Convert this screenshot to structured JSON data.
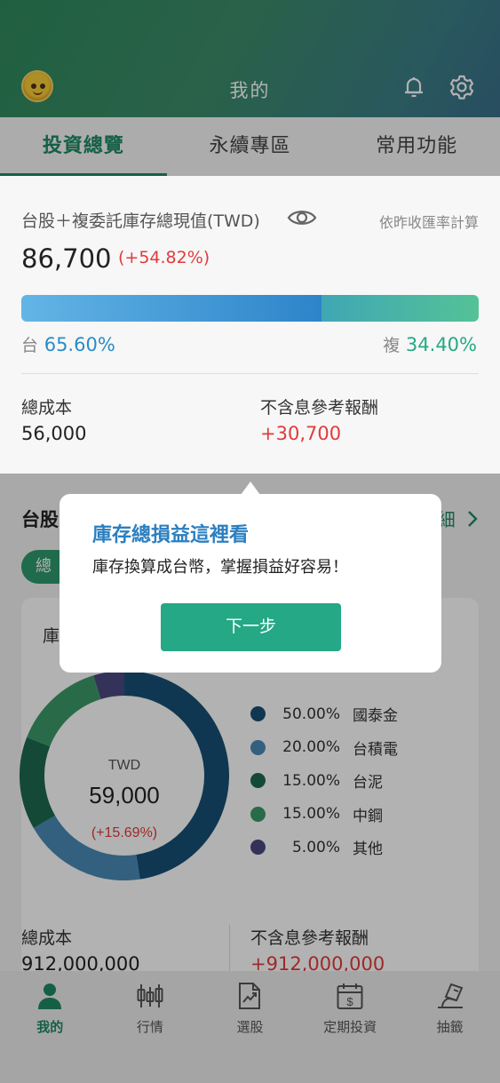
{
  "header": {
    "title": "我的",
    "avatar": "avatar",
    "icons": [
      "bell-icon",
      "gear-icon"
    ]
  },
  "tabs": [
    {
      "label": "投資總覽",
      "active": true
    },
    {
      "label": "永續專區",
      "active": false
    },
    {
      "label": "常用功能",
      "active": false
    }
  ],
  "summary": {
    "label": "台股＋複委託庫存總現值(TWD)",
    "note": "依昨收匯率計算",
    "value": "86,700",
    "change": "(+54.82%)",
    "tw_key": "台",
    "tw_pct": "65.60%",
    "tw_fraction": 0.656,
    "sub_key": "複",
    "sub_pct": "34.40%",
    "cost_label": "總成本",
    "cost_value": "56,000",
    "return_label": "不含息參考報酬",
    "return_value": "+30,700"
  },
  "section": {
    "title": "台股",
    "link": "細",
    "chip": "總",
    "card_title": "庫"
  },
  "donut": {
    "currency": "TWD",
    "total": "59,000",
    "change": "(+15.69%)",
    "items": [
      {
        "pct": "50.00%",
        "name": "國泰金",
        "value": 50,
        "color": "#174f74"
      },
      {
        "pct": "20.00%",
        "name": "台積電",
        "value": 20,
        "color": "#4a8ab7"
      },
      {
        "pct": "15.00%",
        "name": "台泥",
        "value": 15,
        "color": "#1d6950"
      },
      {
        "pct": "15.00%",
        "name": "中鋼",
        "value": 15,
        "color": "#3c9a69"
      },
      {
        "pct": "5.00%",
        "name": "其他",
        "value": 5,
        "color": "#4c4882"
      }
    ]
  },
  "bottom_stats": {
    "cost_label": "總成本",
    "cost_value": "912,000,000",
    "return_label": "不含息參考報酬",
    "return_value": "+912,000,000"
  },
  "tooltip": {
    "title": "庫存總損益這裡看",
    "body": "庫存換算成台幣，掌握損益好容易！",
    "button": "下一步"
  },
  "nav": [
    {
      "label": "我的",
      "icon": "person-icon",
      "active": true
    },
    {
      "label": "行情",
      "icon": "candlestick-icon",
      "active": false
    },
    {
      "label": "選股",
      "icon": "chart-doc-icon",
      "active": false
    },
    {
      "label": "定期投資",
      "icon": "calendar-dollar-icon",
      "active": false
    },
    {
      "label": "抽籤",
      "icon": "lottery-icon",
      "active": false
    }
  ]
}
